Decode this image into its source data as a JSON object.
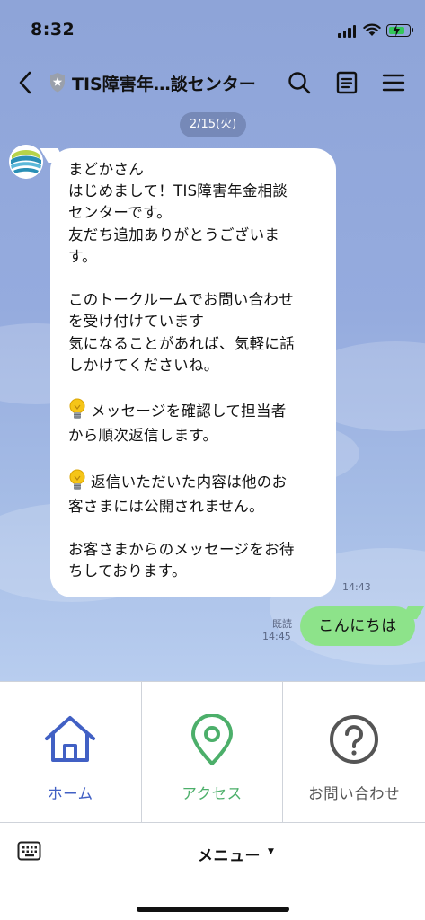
{
  "status_bar": {
    "time": "8:32"
  },
  "header": {
    "title": "TIS障害年…談センター"
  },
  "chat": {
    "date": "2/15(火)",
    "received": {
      "lines": [
        "まどかさん",
        "はじめまして！TIS障害年金相談",
        "センターです。",
        "友だち追加ありがとうございま",
        "す。",
        "",
        "このトークルームでお問い合わせ",
        "を受け付けています",
        "気になることがあれば、気軽に話",
        "しかけてくださいね。",
        "",
        "メッセージを確認して担当者",
        "から順次返信します。",
        "",
        "返信いただいた内容は他のお",
        "客さまには公開されません。",
        "",
        "お客さまからのメッセージをお待",
        "ちしております。"
      ],
      "time": "14:43"
    },
    "sent": {
      "text": "こんにちは",
      "read": "既読",
      "time": "14:45"
    }
  },
  "rich_menu": {
    "items": [
      {
        "label": "ホーム",
        "icon": "home-icon",
        "color": "#4160c4"
      },
      {
        "label": "アクセス",
        "icon": "location-pin-icon",
        "color": "#4caf6a"
      },
      {
        "label": "お問い合わせ",
        "icon": "question-icon",
        "color": "#555555"
      }
    ]
  },
  "bottom_bar": {
    "menu_label": "メニュー"
  },
  "colors": {
    "chat_bg": "#95abde",
    "sent_bubble": "#8de38a",
    "received_bubble": "#ffffff"
  }
}
